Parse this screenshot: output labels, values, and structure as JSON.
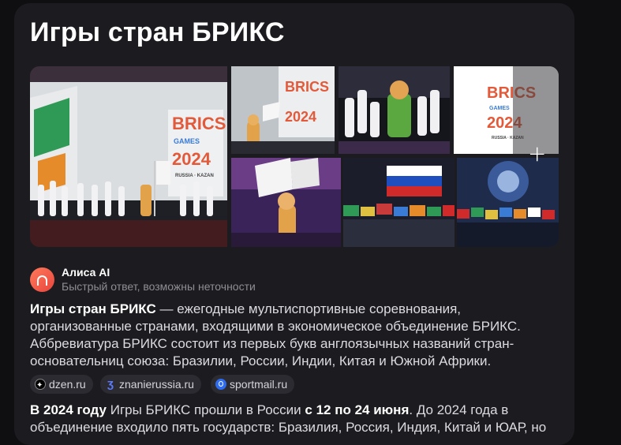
{
  "title": "Игры стран БРИКС",
  "gallery": {
    "tiles": [
      {
        "name": "image-main"
      },
      {
        "name": "image-1"
      },
      {
        "name": "image-2"
      },
      {
        "name": "image-3"
      },
      {
        "name": "image-4"
      },
      {
        "name": "image-5"
      },
      {
        "name": "image-6"
      }
    ],
    "logo_text": {
      "brics": "BRICS",
      "games": "GAMES",
      "year": "2024",
      "city": "RUSSIA · KAZAN"
    },
    "more_icon": "plus-icon"
  },
  "alice": {
    "name": "Алиса AI",
    "subtitle": "Быстрый ответ, возможны неточности"
  },
  "answer": {
    "lead": "Игры стран БРИКС",
    "text": " — ежегодные мультиспортивные соревнования, организованные странами, входящими в экономическое объединение БРИКС. Аббревиатура БРИКС состоит из первых букв англоязычных названий стран-основательниц союза: Бразилии, России, Индии, Китая и Южной Африки."
  },
  "sources": [
    {
      "label": "dzen.ru",
      "icon": "dzen-icon"
    },
    {
      "label": "znanierussia.ru",
      "icon": "znanie-icon"
    },
    {
      "label": "sportmail.ru",
      "icon": "sportmail-icon"
    }
  ],
  "answer2": {
    "bold1": "В 2024 году",
    "text1": " Игры БРИКС прошли в России ",
    "bold2": "с 12 по 24 июня",
    "text2": ". До 2024 года в объединение входило пять государств: Бразилия, Россия, Индия, Китай и ЮАР, но"
  },
  "colors": {
    "accent": "#e8453c",
    "card": "#1c1c20",
    "background": "#0f0f12"
  }
}
